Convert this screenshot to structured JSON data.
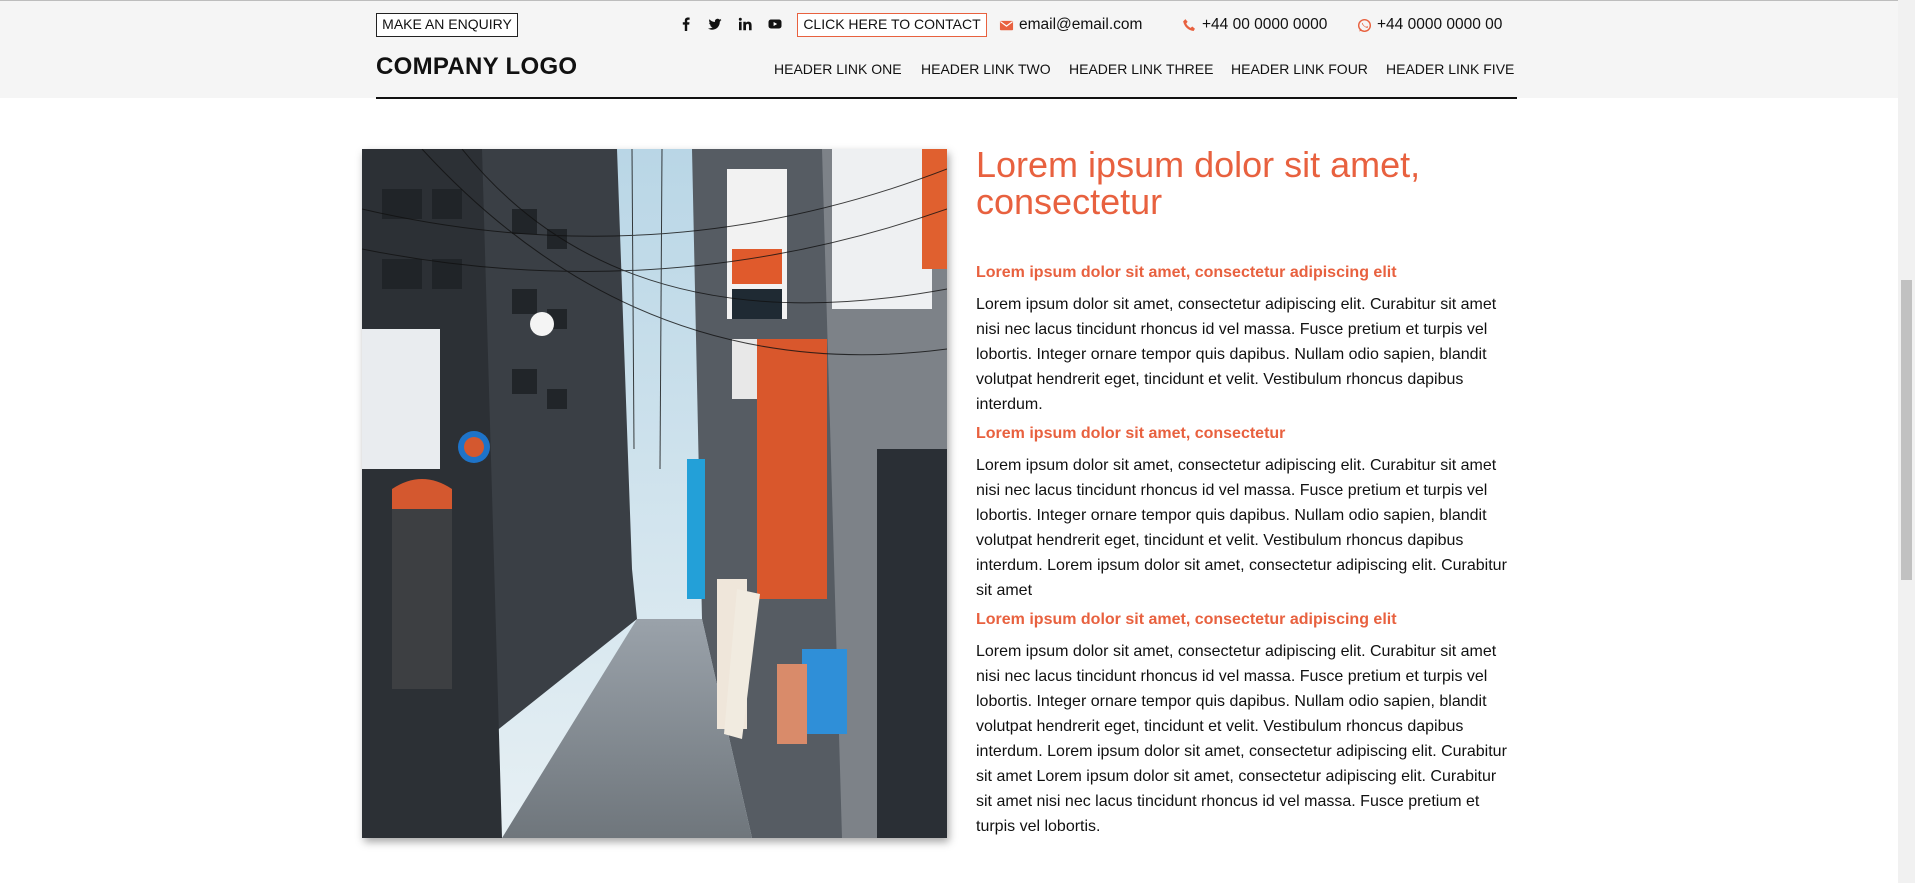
{
  "header": {
    "enquiry_label": "MAKE AN ENQUIRY",
    "contact_label": "CLICK HERE TO CONTACT",
    "email": "email@email.com",
    "phone": "+44 00 0000 0000",
    "whatsapp": "+44 0000 0000 00",
    "logo": "COMPANY LOGO",
    "nav": [
      "HEADER LINK ONE",
      "HEADER LINK TWO",
      "HEADER LINK THREE",
      "HEADER LINK FOUR",
      "HEADER LINK FIVE"
    ],
    "social_icons": [
      "facebook-icon",
      "twitter-icon",
      "linkedin-icon",
      "youtube-icon"
    ]
  },
  "colors": {
    "accent": "#e8613f",
    "header_bg": "#f5f5f5",
    "text": "#111111"
  },
  "main": {
    "title": "Lorem ipsum dolor sit amet, consectetur",
    "sections": [
      {
        "heading": "Lorem ipsum dolor sit amet, consectetur adipiscing elit",
        "body": "Lorem ipsum dolor sit amet, consectetur adipiscing elit. Curabitur sit amet nisi nec lacus tincidunt rhoncus id vel massa. Fusce pretium et turpis vel lobortis. Integer ornare tempor quis dapibus. Nullam odio sapien, blandit volutpat hendrerit eget, tincidunt et velit. Vestibulum rhoncus dapibus interdum."
      },
      {
        "heading": "Lorem ipsum dolor sit amet, consectetur",
        "body": "Lorem ipsum dolor sit amet, consectetur adipiscing elit. Curabitur sit amet nisi nec lacus tincidunt rhoncus id vel massa. Fusce pretium et turpis vel lobortis. Integer ornare tempor quis dapibus. Nullam odio sapien, blandit volutpat hendrerit eget, tincidunt et velit. Vestibulum rhoncus dapibus interdum. Lorem ipsum dolor sit amet, consectetur adipiscing elit. Curabitur sit amet"
      },
      {
        "heading": "Lorem ipsum dolor sit amet, consectetur adipiscing elit",
        "body": "Lorem ipsum dolor sit amet, consectetur adipiscing elit. Curabitur sit amet nisi nec lacus tincidunt rhoncus id vel massa. Fusce pretium et turpis vel lobortis. Integer ornare tempor quis dapibus. Nullam odio sapien, blandit volutpat hendrerit eget, tincidunt et velit. Vestibulum rhoncus dapibus interdum. Lorem ipsum dolor sit amet, consectetur adipiscing elit. Curabitur sit amet Lorem ipsum dolor sit amet, consectetur adipiscing elit. Curabitur sit amet nisi nec lacus tincidunt rhoncus id vel massa. Fusce pretium et turpis vel lobortis."
      }
    ]
  }
}
